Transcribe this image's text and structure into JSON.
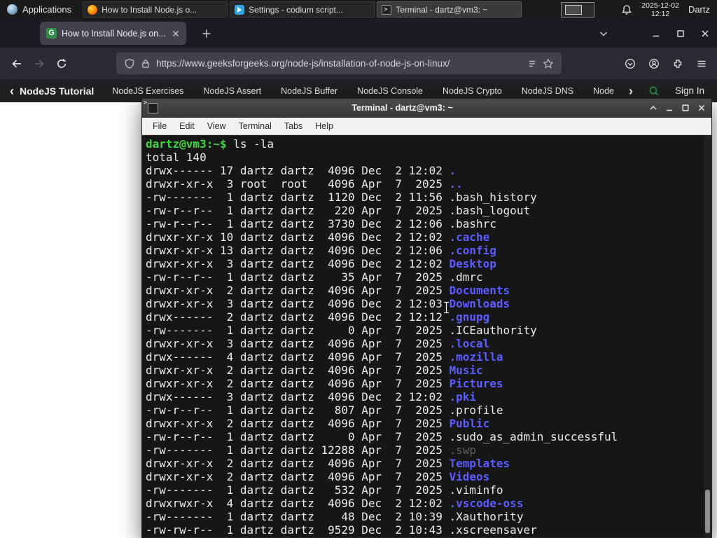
{
  "panel": {
    "applications": "Applications",
    "tasks": [
      {
        "title": "How to Install Node.js o...",
        "icon": "firefox",
        "active": false
      },
      {
        "title": "Settings - codium script...",
        "icon": "codium",
        "active": false
      },
      {
        "title": "Terminal - dartz@vm3: ~",
        "icon": "terminal",
        "active": true
      }
    ],
    "clock": {
      "date": "2025-12-02",
      "time": "12:12"
    },
    "user": "Dartz"
  },
  "browser": {
    "tab_title": "How to Install Node.js on...",
    "url": "https://www.geeksforgeeks.org/node-js/installation-of-node-js-on-linux/"
  },
  "site": {
    "back_chevron": "‹",
    "tutorial": "NodeJS Tutorial",
    "links": [
      "NodeJS Exercises",
      "NodeJS Assert",
      "NodeJS Buffer",
      "NodeJS Console",
      "NodeJS Crypto",
      "NodeJS DNS",
      "Node"
    ],
    "more_chevron": "›",
    "sign_in": "Sign In"
  },
  "terminal": {
    "title": "Terminal - dartz@vm3: ~",
    "menu": [
      "File",
      "Edit",
      "View",
      "Terminal",
      "Tabs",
      "Help"
    ],
    "prompt": "dartz@vm3:~$",
    "command": "ls -la",
    "total": "total 140",
    "rows": [
      {
        "p": "drwx------ 17 dartz dartz  4096 Dec  2 12:02 ",
        "n": ".",
        "c": "d"
      },
      {
        "p": "drwxr-xr-x  3 root  root   4096 Apr  7  2025 ",
        "n": "..",
        "c": "d"
      },
      {
        "p": "-rw-------  1 dartz dartz  1120 Dec  2 11:56 ",
        "n": ".bash_history",
        "c": "f"
      },
      {
        "p": "-rw-r--r--  1 dartz dartz   220 Apr  7  2025 ",
        "n": ".bash_logout",
        "c": "f"
      },
      {
        "p": "-rw-r--r--  1 dartz dartz  3730 Dec  2 12:06 ",
        "n": ".bashrc",
        "c": "f"
      },
      {
        "p": "drwxr-xr-x 10 dartz dartz  4096 Dec  2 12:02 ",
        "n": ".cache",
        "c": "d"
      },
      {
        "p": "drwxr-xr-x 13 dartz dartz  4096 Dec  2 12:06 ",
        "n": ".config",
        "c": "d"
      },
      {
        "p": "drwxr-xr-x  3 dartz dartz  4096 Dec  2 12:02 ",
        "n": "Desktop",
        "c": "d"
      },
      {
        "p": "-rw-r--r--  1 dartz dartz    35 Apr  7  2025 ",
        "n": ".dmrc",
        "c": "f"
      },
      {
        "p": "drwxr-xr-x  2 dartz dartz  4096 Apr  7  2025 ",
        "n": "Documents",
        "c": "d"
      },
      {
        "p": "drwxr-xr-x  3 dartz dartz  4096 Dec  2 12:03 ",
        "n": "Downloads",
        "c": "d"
      },
      {
        "p": "drwx------  2 dartz dartz  4096 Dec  2 12:12 ",
        "n": ".gnupg",
        "c": "d"
      },
      {
        "p": "-rw-------  1 dartz dartz     0 Apr  7  2025 ",
        "n": ".ICEauthority",
        "c": "f"
      },
      {
        "p": "drwxr-xr-x  3 dartz dartz  4096 Apr  7  2025 ",
        "n": ".local",
        "c": "d"
      },
      {
        "p": "drwx------  4 dartz dartz  4096 Apr  7  2025 ",
        "n": ".mozilla",
        "c": "d"
      },
      {
        "p": "drwxr-xr-x  2 dartz dartz  4096 Apr  7  2025 ",
        "n": "Music",
        "c": "d"
      },
      {
        "p": "drwxr-xr-x  2 dartz dartz  4096 Apr  7  2025 ",
        "n": "Pictures",
        "c": "d"
      },
      {
        "p": "drwx------  3 dartz dartz  4096 Dec  2 12:02 ",
        "n": ".pki",
        "c": "d"
      },
      {
        "p": "-rw-r--r--  1 dartz dartz   807 Apr  7  2025 ",
        "n": ".profile",
        "c": "f"
      },
      {
        "p": "drwxr-xr-x  2 dartz dartz  4096 Apr  7  2025 ",
        "n": "Public",
        "c": "d"
      },
      {
        "p": "-rw-r--r--  1 dartz dartz     0 Apr  7  2025 ",
        "n": ".sudo_as_admin_successful",
        "c": "f"
      },
      {
        "p": "-rw-------  1 dartz dartz 12288 Apr  7  2025 ",
        "n": ".swp",
        "c": "x"
      },
      {
        "p": "drwxr-xr-x  2 dartz dartz  4096 Apr  7  2025 ",
        "n": "Templates",
        "c": "d"
      },
      {
        "p": "drwxr-xr-x  2 dartz dartz  4096 Apr  7  2025 ",
        "n": "Videos",
        "c": "d"
      },
      {
        "p": "-rw-------  1 dartz dartz   532 Apr  7  2025 ",
        "n": ".viminfo",
        "c": "f"
      },
      {
        "p": "drwxrwxr-x  4 dartz dartz  4096 Dec  2 12:02 ",
        "n": ".vscode-oss",
        "c": "d"
      },
      {
        "p": "-rw-------  1 dartz dartz    48 Dec  2 10:39 ",
        "n": ".Xauthority",
        "c": "f"
      },
      {
        "p": "-rw-rw-r--  1 dartz dartz  9529 Dec  2 10:43 ",
        "n": ".xscreensaver",
        "c": "f"
      }
    ]
  }
}
